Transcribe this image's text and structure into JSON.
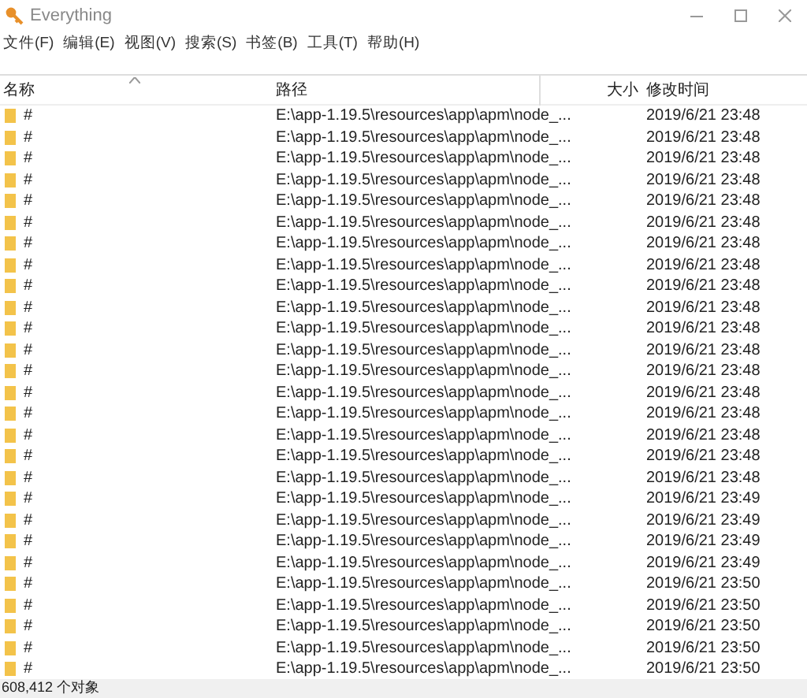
{
  "window": {
    "title": "Everything"
  },
  "menu": [
    "文件(F)",
    "编辑(E)",
    "视图(V)",
    "搜索(S)",
    "书签(B)",
    "工具(T)",
    "帮助(H)"
  ],
  "columns": [
    {
      "label": "名称",
      "sorted": true
    },
    {
      "label": "路径",
      "sorted": false
    },
    {
      "label": "大小",
      "sorted": false
    },
    {
      "label": "修改时间",
      "sorted": false
    }
  ],
  "rows": [
    {
      "name": "#",
      "path": "E:\\app-1.19.5\\resources\\app\\apm\\node_...",
      "modified": "2019/6/21 23:48"
    },
    {
      "name": "#",
      "path": "E:\\app-1.19.5\\resources\\app\\apm\\node_...",
      "modified": "2019/6/21 23:48"
    },
    {
      "name": "#",
      "path": "E:\\app-1.19.5\\resources\\app\\apm\\node_...",
      "modified": "2019/6/21 23:48"
    },
    {
      "name": "#",
      "path": "E:\\app-1.19.5\\resources\\app\\apm\\node_...",
      "modified": "2019/6/21 23:48"
    },
    {
      "name": "#",
      "path": "E:\\app-1.19.5\\resources\\app\\apm\\node_...",
      "modified": "2019/6/21 23:48"
    },
    {
      "name": "#",
      "path": "E:\\app-1.19.5\\resources\\app\\apm\\node_...",
      "modified": "2019/6/21 23:48"
    },
    {
      "name": "#",
      "path": "E:\\app-1.19.5\\resources\\app\\apm\\node_...",
      "modified": "2019/6/21 23:48"
    },
    {
      "name": "#",
      "path": "E:\\app-1.19.5\\resources\\app\\apm\\node_...",
      "modified": "2019/6/21 23:48"
    },
    {
      "name": "#",
      "path": "E:\\app-1.19.5\\resources\\app\\apm\\node_...",
      "modified": "2019/6/21 23:48"
    },
    {
      "name": "#",
      "path": "E:\\app-1.19.5\\resources\\app\\apm\\node_...",
      "modified": "2019/6/21 23:48"
    },
    {
      "name": "#",
      "path": "E:\\app-1.19.5\\resources\\app\\apm\\node_...",
      "modified": "2019/6/21 23:48"
    },
    {
      "name": "#",
      "path": "E:\\app-1.19.5\\resources\\app\\apm\\node_...",
      "modified": "2019/6/21 23:48"
    },
    {
      "name": "#",
      "path": "E:\\app-1.19.5\\resources\\app\\apm\\node_...",
      "modified": "2019/6/21 23:48"
    },
    {
      "name": "#",
      "path": "E:\\app-1.19.5\\resources\\app\\apm\\node_...",
      "modified": "2019/6/21 23:48"
    },
    {
      "name": "#",
      "path": "E:\\app-1.19.5\\resources\\app\\apm\\node_...",
      "modified": "2019/6/21 23:48"
    },
    {
      "name": "#",
      "path": "E:\\app-1.19.5\\resources\\app\\apm\\node_...",
      "modified": "2019/6/21 23:48"
    },
    {
      "name": "#",
      "path": "E:\\app-1.19.5\\resources\\app\\apm\\node_...",
      "modified": "2019/6/21 23:48"
    },
    {
      "name": "#",
      "path": "E:\\app-1.19.5\\resources\\app\\apm\\node_...",
      "modified": "2019/6/21 23:48"
    },
    {
      "name": "#",
      "path": "E:\\app-1.19.5\\resources\\app\\apm\\node_...",
      "modified": "2019/6/21 23:49"
    },
    {
      "name": "#",
      "path": "E:\\app-1.19.5\\resources\\app\\apm\\node_...",
      "modified": "2019/6/21 23:49"
    },
    {
      "name": "#",
      "path": "E:\\app-1.19.5\\resources\\app\\apm\\node_...",
      "modified": "2019/6/21 23:49"
    },
    {
      "name": "#",
      "path": "E:\\app-1.19.5\\resources\\app\\apm\\node_...",
      "modified": "2019/6/21 23:49"
    },
    {
      "name": "#",
      "path": "E:\\app-1.19.5\\resources\\app\\apm\\node_...",
      "modified": "2019/6/21 23:50"
    },
    {
      "name": "#",
      "path": "E:\\app-1.19.5\\resources\\app\\apm\\node_...",
      "modified": "2019/6/21 23:50"
    },
    {
      "name": "#",
      "path": "E:\\app-1.19.5\\resources\\app\\apm\\node_...",
      "modified": "2019/6/21 23:50"
    },
    {
      "name": "#",
      "path": "E:\\app-1.19.5\\resources\\app\\apm\\node_...",
      "modified": "2019/6/21 23:50"
    },
    {
      "name": "#",
      "path": "E:\\app-1.19.5\\resources\\app\\apm\\node_...",
      "modified": "2019/6/21 23:50"
    }
  ],
  "status_bar": "608,412 个对象"
}
